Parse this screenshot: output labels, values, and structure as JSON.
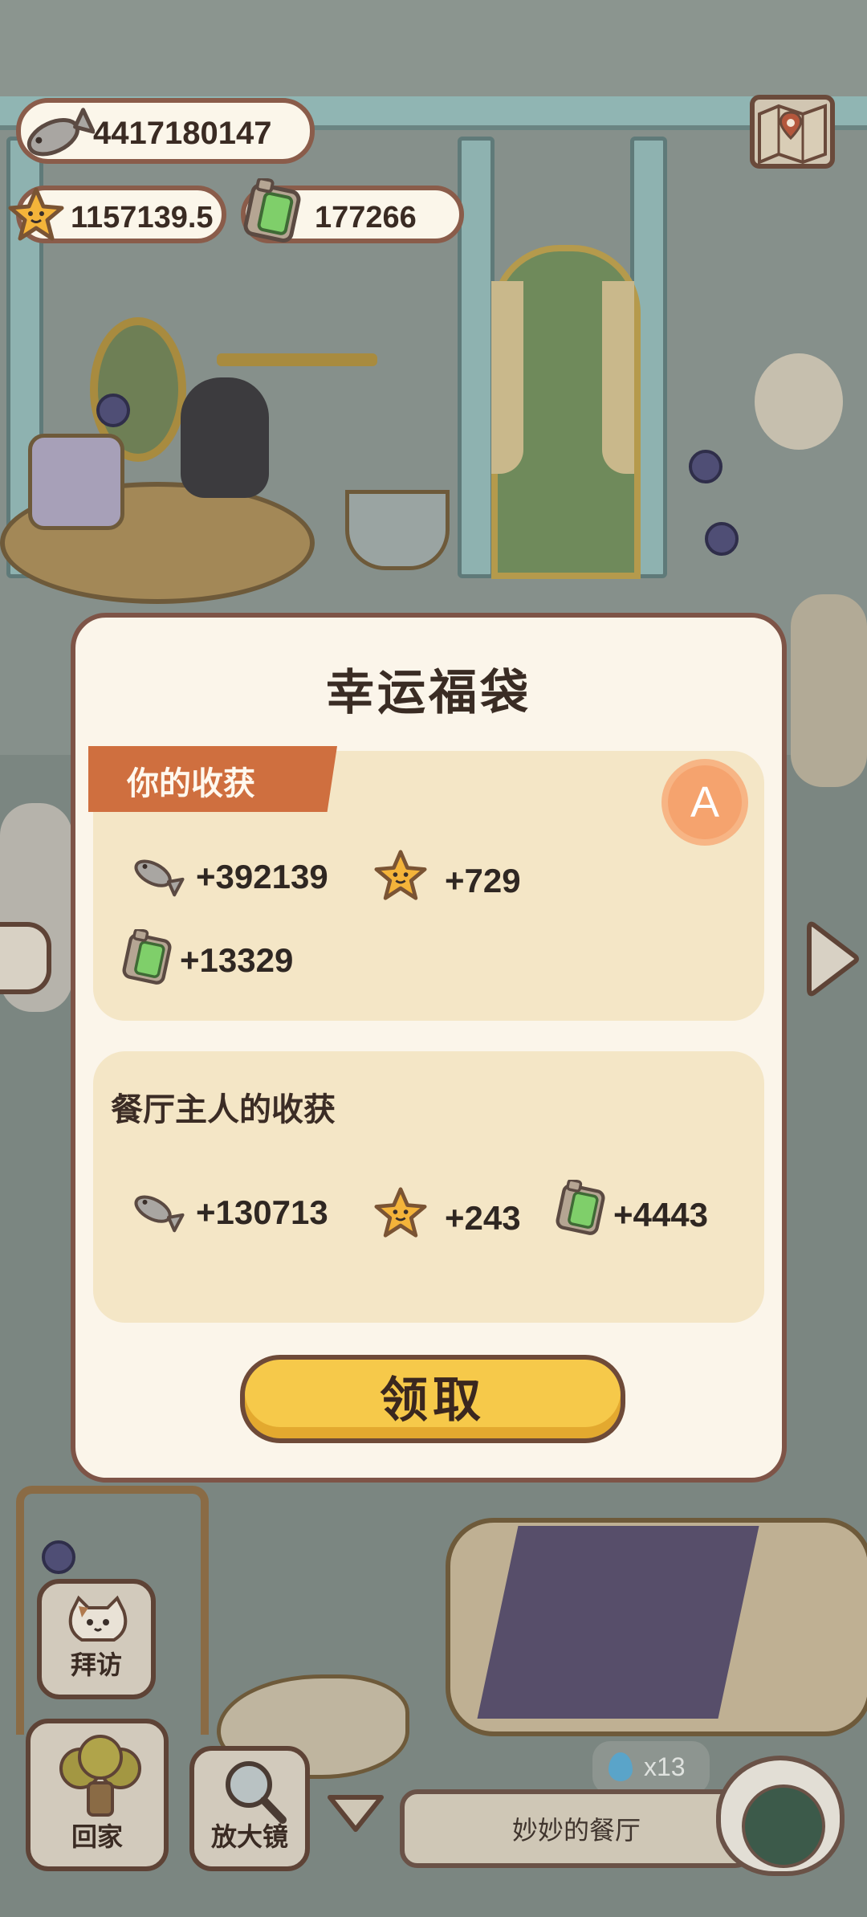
{
  "hud": {
    "fish": "4417180147",
    "stars": "1157139.5",
    "tickets": "177266"
  },
  "modal": {
    "title": "幸运福袋",
    "your_rewards": {
      "label": "你的收获",
      "grade": "A",
      "fish": "+392139",
      "stars": "+729",
      "tickets": "+13329"
    },
    "owner_rewards": {
      "label": "餐厅主人的收获",
      "fish": "+130713",
      "stars": "+243",
      "tickets": "+4443"
    },
    "claim_label": "领取"
  },
  "bottom": {
    "visit_label": "拜访",
    "home_label": "回家",
    "magnifier_label": "放大镜",
    "water_count": "x13",
    "restaurant_name": "妙妙的餐厅"
  },
  "icons": [
    "fish-icon",
    "star-icon",
    "ticket-icon",
    "map-icon",
    "water-drop-icon",
    "magnifier-icon",
    "chevron-down-icon"
  ],
  "colors": {
    "modal_bg": "#fbf5ea",
    "card_bg": "#f4e6c6",
    "ribbon": "#cf6f3f",
    "button": "#f6c94a",
    "border": "#7e5447"
  }
}
